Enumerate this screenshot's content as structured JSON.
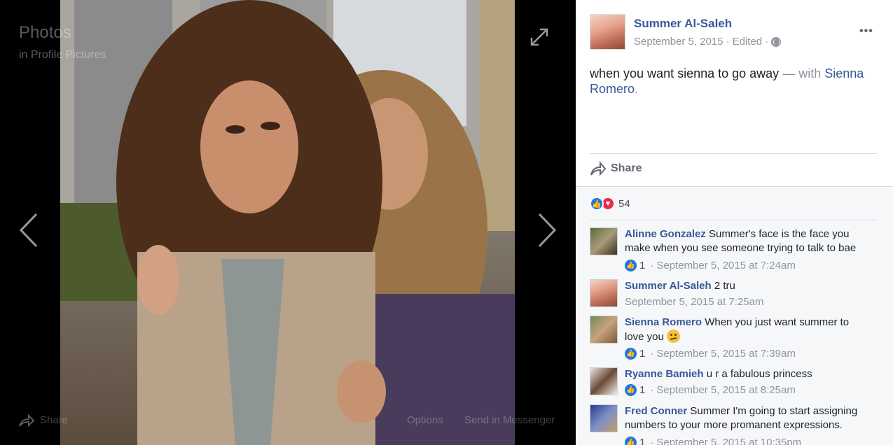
{
  "viewer": {
    "title": "Photos",
    "subtitle": "in Profile Pictures",
    "share_label": "Share",
    "options_label": "Options",
    "send_label": "Send in Messenger"
  },
  "post": {
    "author": "Summer Al-Saleh",
    "date": "September 5, 2015",
    "edited": "Edited",
    "dot": "·",
    "text": "when you want sienna to go away",
    "with_label": "— with",
    "tagged": "Sienna Romero",
    "period": ".",
    "share_label": "Share",
    "more_label": "•••"
  },
  "reactions": {
    "count": "54"
  },
  "comments": [
    {
      "author": "Alinne Gonzalez",
      "text": "Summer's face is the face you make when you see someone trying to talk to bae",
      "likes": "1",
      "time": "September 5, 2015 at 7:24am"
    },
    {
      "author": "Summer Al-Saleh",
      "text": "2 tru",
      "likes": "",
      "time": "September 5, 2015 at 7:25am"
    },
    {
      "author": "Sienna Romero",
      "text": "When you just want summer to love you",
      "likes": "1",
      "time": "September 5, 2015 at 7:39am"
    },
    {
      "author": "Ryanne Bamieh",
      "text": "u r a fabulous princess",
      "likes": "1",
      "time": "September 5, 2015 at 8:25am"
    },
    {
      "author": "Fred Conner",
      "text": "Summer I'm going to start assigning numbers to your more promanent expressions.",
      "likes": "1",
      "time": "September 5, 2015 at 10:35pm"
    }
  ],
  "colors": {
    "link": "#385898",
    "like_blue": "#1f75e8",
    "love_red": "#f0284a",
    "meta_gray": "#90949c"
  },
  "icons": {
    "expand": "expand-icon",
    "prev": "chevron-left-icon",
    "next": "chevron-right-icon",
    "share": "share-arrow-icon",
    "globe": "globe-icon",
    "like": "thumbs-up-icon",
    "love": "heart-icon"
  }
}
